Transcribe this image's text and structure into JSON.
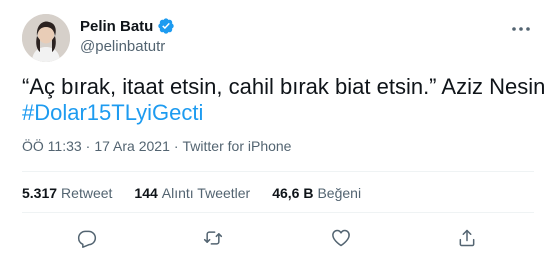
{
  "author": {
    "display_name": "Pelin Batu",
    "handle": "@pelinbatutr",
    "verified": true
  },
  "tweet": {
    "text": "“Aç bırak, itaat etsin, cahil bırak biat etsin.” Aziz Nesin",
    "hashtag": "#Dolar15TLyiGecti",
    "time": "ÖÖ 11:33",
    "separator": "·",
    "date": "17 Ara 2021",
    "source": "Twitter for iPhone"
  },
  "stats": [
    {
      "count": "5.317",
      "label": "Retweet"
    },
    {
      "count": "144",
      "label": "Alıntı Tweetler"
    },
    {
      "count": "46,6 B",
      "label": "Beğeni"
    }
  ],
  "actions": {
    "reply_icon": "comment-icon",
    "retweet_icon": "retweet-icon",
    "like_icon": "heart-icon",
    "share_icon": "share-icon"
  },
  "colors": {
    "accent": "#1d9bf0",
    "text_primary": "#0f1419",
    "text_secondary": "#536471",
    "divider": "#eff3f4"
  }
}
